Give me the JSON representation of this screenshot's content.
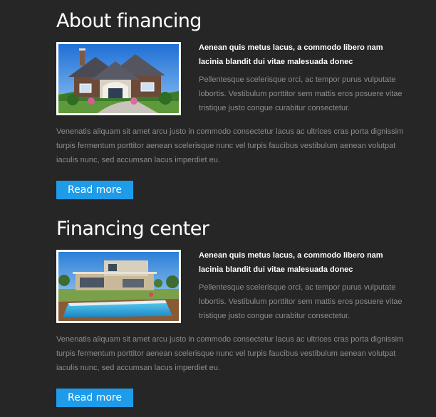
{
  "sections": [
    {
      "title": "About financing",
      "lead": "Aenean quis metus lacus, a commodo libero nam lacinia blandit dui vitae malesuada donec",
      "text": "Pellentesque scelerisque orci, ac tempor purus vulputate lobortis. Vestibulum porttitor sem mattis eros posuere vitae tristique justo congue curabitur consectetur.",
      "body": "Venenatis aliquam sit amet arcu justo in commodo consectetur lacus ac ultrices cras porta dignissim turpis fermentum porttitor aenean scelerisque nunc vel turpis faucibus vestibulum aenean volutpat iaculis nunc, sed accumsan lacus imperdiet eu.",
      "button": "Read more",
      "image": "house-photo"
    },
    {
      "title": "Financing center",
      "lead": "Aenean quis metus lacus, a commodo libero nam lacinia blandit dui vitae malesuada donec",
      "text": "Pellentesque scelerisque orci, ac tempor purus vulputate lobortis. Vestibulum porttitor sem mattis eros posuere vitae tristique justo congue curabitur consectetur.",
      "body": "Venenatis aliquam sit amet arcu justo in commodo consectetur lacus ac ultrices cras porta dignissim turpis fermentum porttitor aenean scelerisque nunc vel turpis faucibus vestibulum aenean volutpat iaculis nunc, sed accumsan lacus imperdiet eu.",
      "button": "Read more",
      "image": "modern-house-pool-photo"
    }
  ],
  "colors": {
    "background": "#262626",
    "accent": "#1e9be9",
    "heading": "#ffffff",
    "text": "#8d8d8d"
  }
}
